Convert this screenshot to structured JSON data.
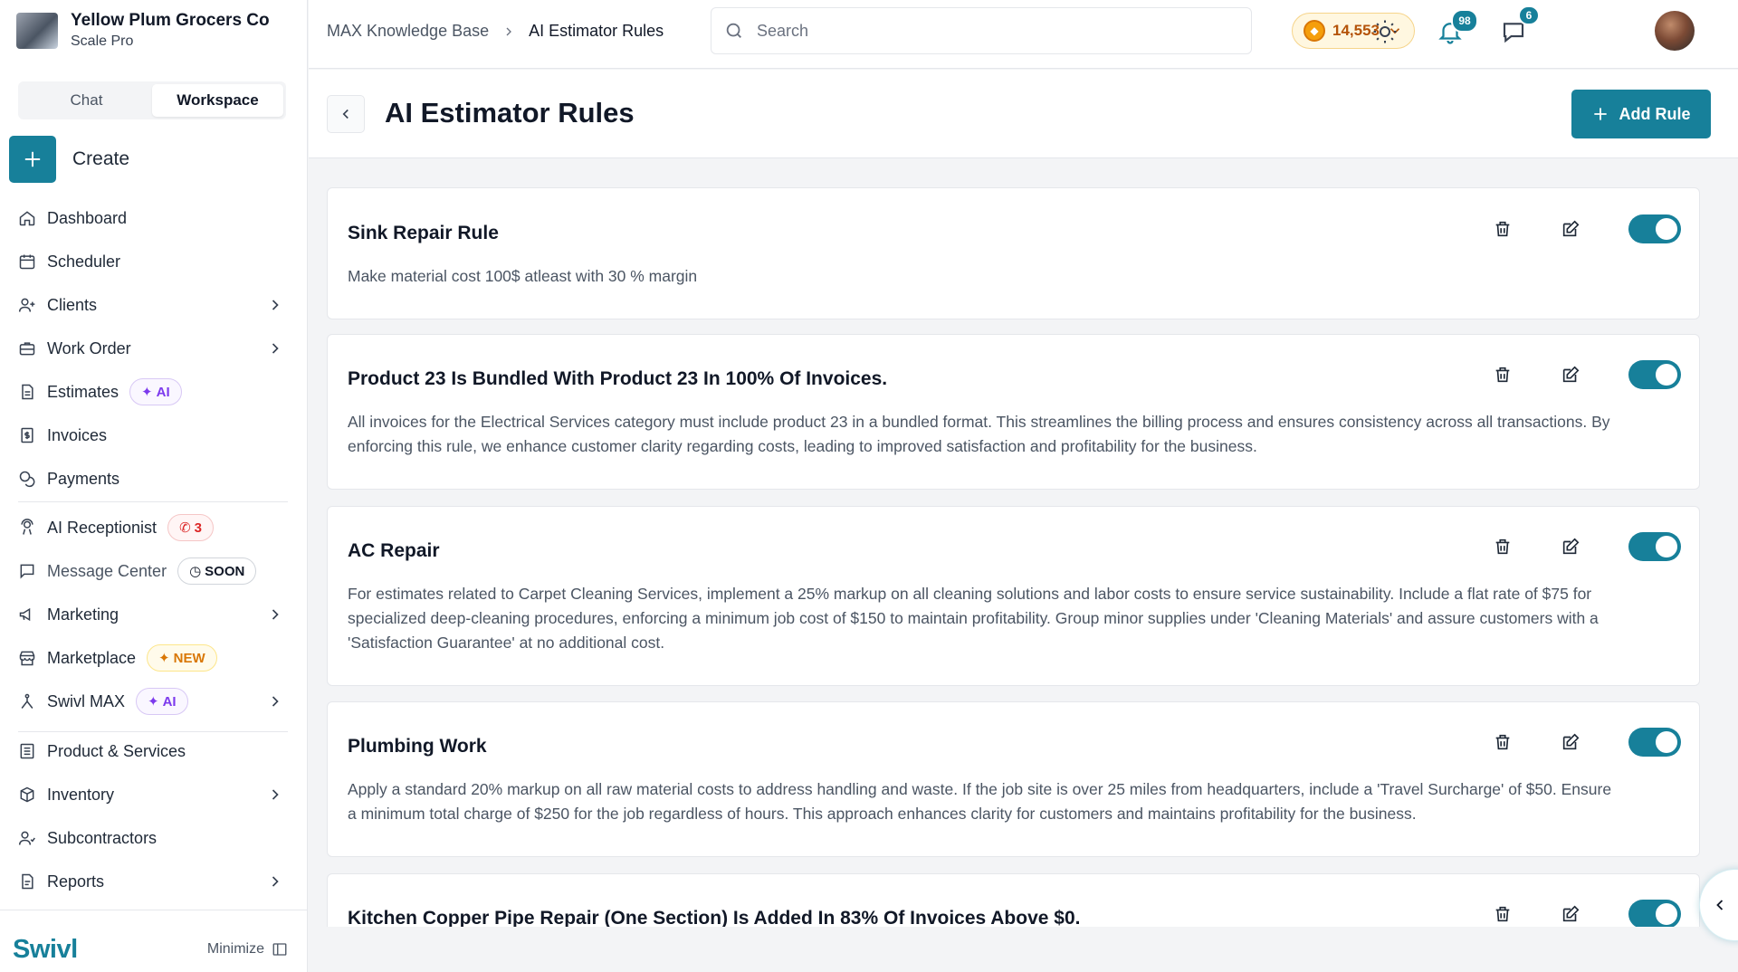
{
  "company": {
    "name": "Yellow Plum Grocers Co",
    "plan": "Scale Pro"
  },
  "mode_switch": {
    "chat": "Chat",
    "workspace": "Workspace",
    "active": "Workspace"
  },
  "create": {
    "label": "Create",
    "icon": "plus-icon"
  },
  "nav": {
    "dashboard": "Dashboard",
    "scheduler": "Scheduler",
    "clients": "Clients",
    "work_order": "Work Order",
    "estimates": "Estimates",
    "estimates_badge": "AI",
    "invoices": "Invoices",
    "payments": "Payments",
    "ai_receptionist": "AI Receptionist",
    "ai_receptionist_badge": "3",
    "message_center": "Message Center",
    "message_center_badge": "SOON",
    "marketing": "Marketing",
    "marketplace": "Marketplace",
    "marketplace_badge": "NEW",
    "swivl_max": "Swivl MAX",
    "swivl_max_badge": "AI",
    "product_services": "Product & Services",
    "inventory": "Inventory",
    "subcontractors": "Subcontractors",
    "reports": "Reports"
  },
  "footer": {
    "brand": "Swivl",
    "minimize": "Minimize"
  },
  "breadcrumb": {
    "parent": "MAX Knowledge Base",
    "current": "AI Estimator Rules"
  },
  "search": {
    "placeholder": "Search",
    "value": ""
  },
  "points": {
    "value": "14,553"
  },
  "notifications": {
    "count": "98"
  },
  "messages": {
    "count": "6"
  },
  "page": {
    "title": "AI Estimator Rules",
    "add_button": "Add Rule"
  },
  "rules": [
    {
      "title": "Sink Repair Rule",
      "description": "Make material cost 100$ atleast with 30 % margin",
      "enabled": true
    },
    {
      "title": "Product 23 Is Bundled With Product 23 In 100% Of Invoices.",
      "description": "All invoices for the Electrical Services category must include product 23 in a bundled format. This streamlines the billing process and ensures consistency across all transactions. By enforcing this rule, we enhance customer clarity regarding costs, leading to improved satisfaction and profitability for the business.",
      "enabled": true
    },
    {
      "title": "AC Repair",
      "description": "For estimates related to Carpet Cleaning Services, implement a 25% markup on all cleaning solutions and labor costs to ensure service sustainability. Include a flat rate of $75 for specialized deep-cleaning procedures, enforcing a minimum job cost of $150 to maintain profitability. Group minor supplies under 'Cleaning Materials' and assure customers with a 'Satisfaction Guarantee' at no additional cost.",
      "enabled": true
    },
    {
      "title": "Plumbing Work",
      "description": "Apply a standard 20% markup on all raw material costs to address handling and waste. If the job site is over 25 miles from headquarters, include a 'Travel Surcharge' of $50. Ensure a minimum total charge of $250 for the job regardless of hours. This approach enhances clarity for customers and maintains profitability for the business.",
      "enabled": true
    },
    {
      "title": "Kitchen Copper Pipe Repair (One Section) Is Added In 83% Of Invoices Above $0.",
      "description": "",
      "enabled": true
    }
  ],
  "colors": {
    "accent": "#17809a",
    "ai_badge": "#7c3aed",
    "new_badge": "#d97706",
    "call_badge": "#dc2626",
    "points": "#b45309"
  }
}
